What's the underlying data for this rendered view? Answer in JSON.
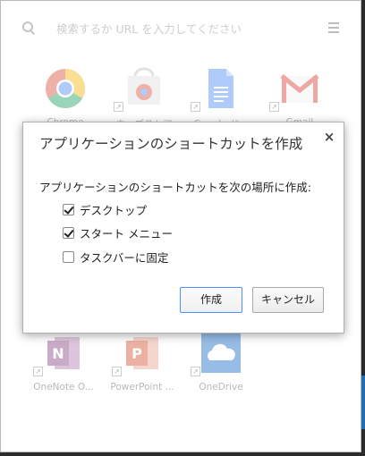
{
  "search": {
    "placeholder": "検索するか URL を入力してください"
  },
  "apps_top": [
    {
      "label": "Chrome"
    },
    {
      "label": "ウェブストア"
    },
    {
      "label": "Google ド..."
    },
    {
      "label": "Gmail"
    }
  ],
  "apps_bottom": [
    {
      "label": "OneNote O..."
    },
    {
      "label": "PowerPoint ..."
    },
    {
      "label": "OneDrive"
    }
  ],
  "dialog": {
    "title": "アプリケーションのショートカットを作成",
    "description": "アプリケーションのショートカットを次の場所に作成:",
    "options": [
      {
        "label": "デスクトップ",
        "checked": true
      },
      {
        "label": "スタート メニュー",
        "checked": true
      },
      {
        "label": "タスクバーに固定",
        "checked": false
      }
    ],
    "create_label": "作成",
    "cancel_label": "キャンセル",
    "close_label": "×"
  },
  "colors": {
    "onenote": "#80397b",
    "powerpoint": "#d24726",
    "onedrive": "#0a64c8",
    "gmail": "#d93025",
    "docs": "#4285f4"
  }
}
